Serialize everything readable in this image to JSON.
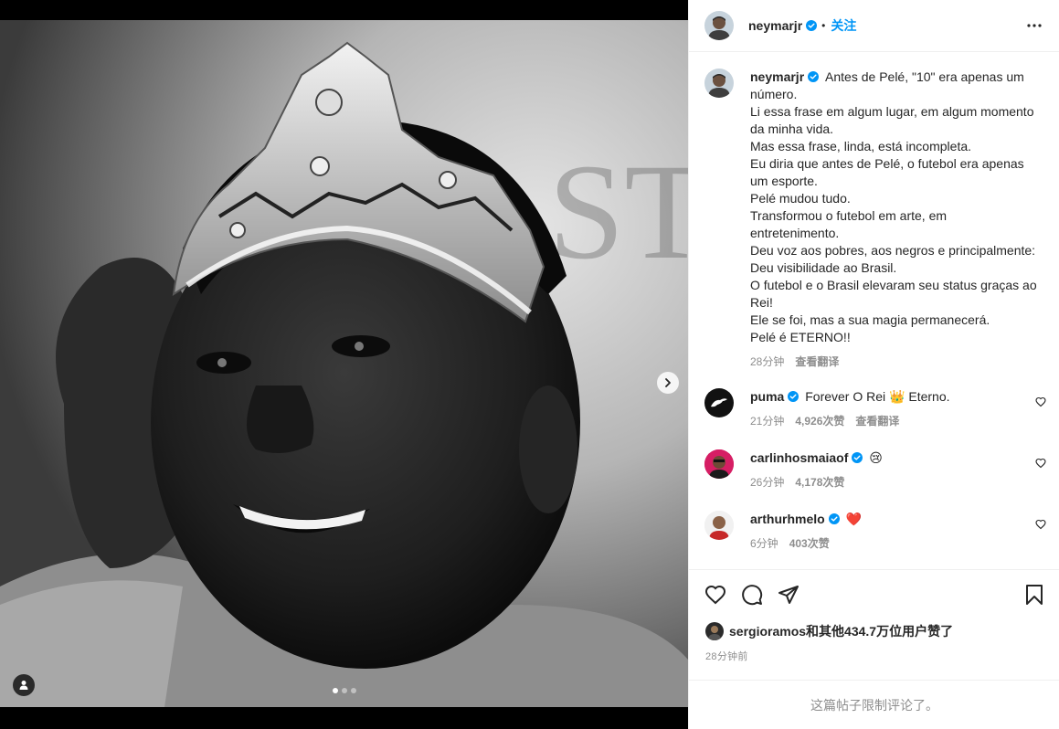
{
  "post": {
    "author": "neymarjr",
    "follow_label": "关注",
    "separator": "•",
    "caption_lines": [
      "Antes de Pelé, \"10\" era apenas um número.",
      "Li essa frase em algum lugar, em algum momento da minha vida.",
      "Mas essa frase, linda, está incompleta.",
      "Eu diria que antes de Pelé, o futebol era apenas um esporte.",
      "Pelé mudou tudo.",
      "Transformou o futebol em arte, em entretenimento.",
      "Deu voz aos pobres, aos negros e principalmente: Deu visibilidade ao Brasil.",
      "O futebol e o Brasil elevaram seu status graças ao Rei!",
      "Ele se foi, mas a sua magia permanecerá.",
      "Pelé é ETERNO!!"
    ],
    "caption_time": "28分钟",
    "see_translation": "查看翻译",
    "carousel": {
      "total": 3,
      "active_index": 0
    }
  },
  "comments": [
    {
      "user": "puma",
      "text": "Forever O Rei 👑 Eterno.",
      "time": "21分钟",
      "likes": "4,926次赞",
      "translate": "查看翻译"
    },
    {
      "user": "carlinhosmaiaof",
      "text": "😢",
      "time": "26分钟",
      "likes": "4,178次赞",
      "translate": ""
    },
    {
      "user": "arthurhmelo",
      "text": "❤️",
      "time": "6分钟",
      "likes": "403次赞",
      "translate": ""
    }
  ],
  "footer": {
    "liked_by_user": "sergioramos",
    "liked_by_rest": "和其他434.7万位用户赞了",
    "timestamp": "28分钟前",
    "comments_limited": "这篇帖子限制评论了。"
  },
  "colors": {
    "accent": "#0095f6",
    "verified": "#0095f6",
    "muted": "#8e8e8e",
    "heart_red": "#ed4956"
  },
  "icons": [
    "verified-badge-icon",
    "more-options-icon",
    "heart-icon",
    "comment-icon",
    "share-icon",
    "bookmark-icon",
    "chevron-right-icon",
    "user-tag-icon"
  ]
}
